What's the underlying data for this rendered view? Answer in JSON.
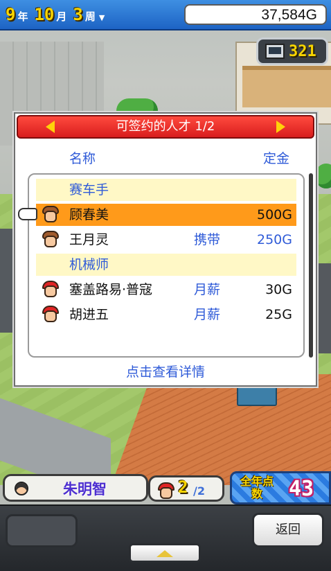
{
  "topbar": {
    "year": "9",
    "year_unit": "年",
    "month": "10",
    "month_unit": "月",
    "week": "3",
    "week_unit": "周",
    "money": "37,584G"
  },
  "research_points": "321",
  "dialog": {
    "title": "可签约的人才 1/2",
    "col_name": "名称",
    "col_fee": "定金",
    "rows": [
      {
        "kind": "category",
        "label": "赛车手"
      },
      {
        "kind": "person",
        "label": "顾春美",
        "terms": "",
        "fee": "500G",
        "avatar": "female-driver-avatar"
      },
      {
        "kind": "person",
        "label": "王月灵",
        "terms": "携带",
        "fee": "250G",
        "avatar": "female-driver-avatar"
      },
      {
        "kind": "category",
        "label": "机械师"
      },
      {
        "kind": "person",
        "label": "塞盖路易·普寇",
        "terms": "月薪",
        "fee": "30G",
        "avatar": "mechanic-avatar"
      },
      {
        "kind": "person",
        "label": "胡进五",
        "terms": "月薪",
        "fee": "25G",
        "avatar": "mechanic-avatar"
      }
    ],
    "hint": "点击查看详情"
  },
  "status": {
    "player_name": "朱明智",
    "team_count": "2",
    "team_max": "/2",
    "score_label": "全年点数",
    "score_value": "43"
  },
  "panel": {
    "back_label": "返回"
  },
  "colors": {
    "accent_blue": "#2f5bd8",
    "selected_row": "#ff9a1a",
    "header_red": "#d81d1d",
    "gold": "#f7d400"
  }
}
